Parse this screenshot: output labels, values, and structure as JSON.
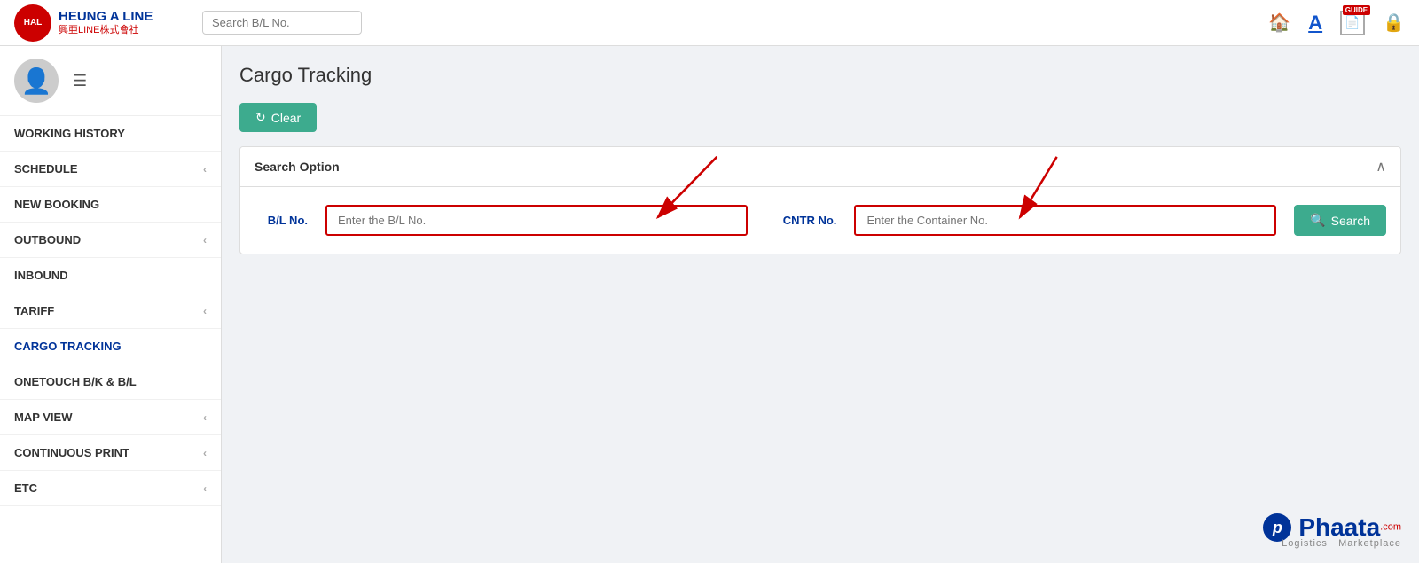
{
  "header": {
    "logo_main": "HEUNG A LINE",
    "logo_sub": "興亜LINE株式會社",
    "logo_abbr": "HAL",
    "search_placeholder": "Search B/L No.",
    "icons": {
      "home": "🏠",
      "font": "A",
      "guide_label": "GUIDE",
      "lock": "🔒"
    }
  },
  "sidebar": {
    "items": [
      {
        "label": "WORKING HISTORY",
        "has_chevron": false
      },
      {
        "label": "SCHEDULE",
        "has_chevron": true
      },
      {
        "label": "NEW BOOKING",
        "has_chevron": false
      },
      {
        "label": "OUTBOUND",
        "has_chevron": true
      },
      {
        "label": "INBOUND",
        "has_chevron": false
      },
      {
        "label": "TARIFF",
        "has_chevron": true
      },
      {
        "label": "CARGO TRACKING",
        "has_chevron": false
      },
      {
        "label": "ONETOUCH B/K & B/L",
        "has_chevron": false
      },
      {
        "label": "MAP VIEW",
        "has_chevron": true
      },
      {
        "label": "CONTINUOUS PRINT",
        "has_chevron": true
      },
      {
        "label": "ETC",
        "has_chevron": true
      }
    ]
  },
  "main": {
    "page_title": "Cargo Tracking",
    "clear_button": "Clear",
    "search_option_title": "Search Option",
    "bl_label": "B/L No.",
    "bl_placeholder": "Enter the B/L No.",
    "cntr_label": "CNTR No.",
    "cntr_placeholder": "Enter the Container No.",
    "search_button": "Search"
  },
  "branding": {
    "phaata_name": "Phaata",
    "phaata_sup": ".com",
    "phaata_sub": "Logistics",
    "marketplace": "Marketplace"
  }
}
